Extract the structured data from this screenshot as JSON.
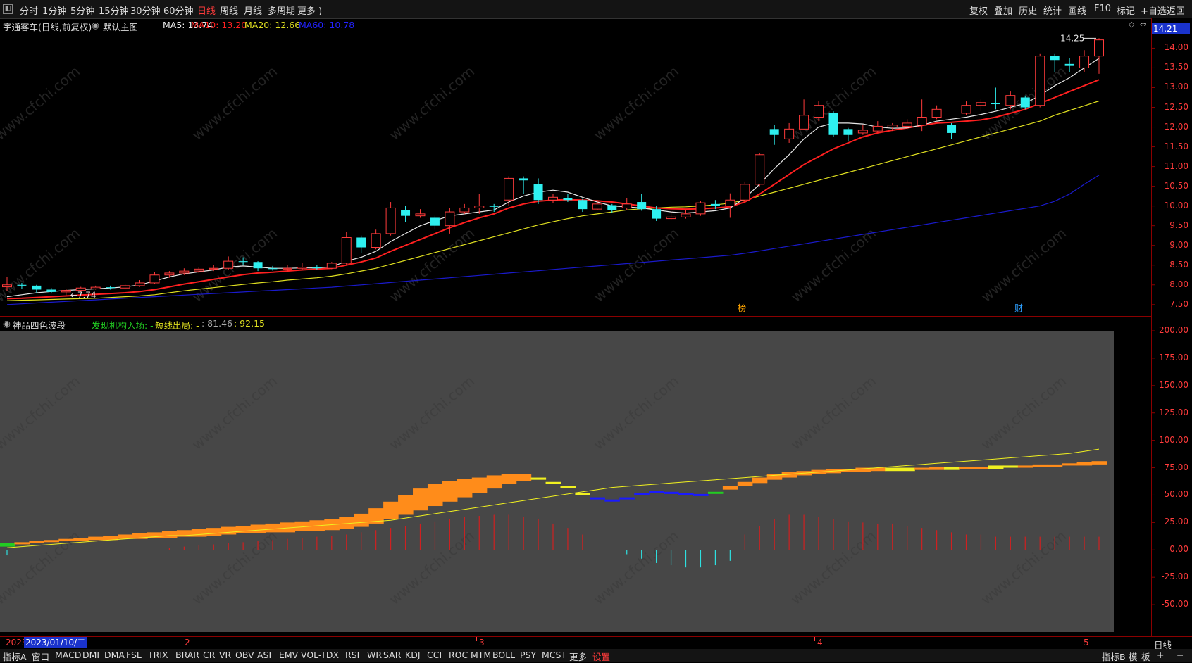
{
  "toolbar": {
    "periods": [
      "分时",
      "1分钟",
      "5分钟",
      "15分钟",
      "30分钟",
      "60分钟",
      "日线",
      "周线",
      "月线",
      "多周期",
      "更多 )"
    ],
    "active_period": "日线",
    "right_tools": [
      "复权",
      "叠加",
      "历史",
      "统计",
      "画线",
      "F10",
      "标记",
      "+自选",
      "返回"
    ]
  },
  "main_header": {
    "stock": "宇通客车(日线,前复权)",
    "template": "默认主图",
    "ma5": "MA5: 13.74",
    "ma10": "MA10: 13.20",
    "ma20": "MA20: 12.66",
    "ma60": "MA60: 10.78"
  },
  "price_tag": "14.21",
  "high_label": "14.25",
  "low_label": "7.74",
  "markers": {
    "bang": "榜",
    "cai": "财"
  },
  "sub_header": {
    "name": "神品四色波段",
    "entry": "发现机构入场: -",
    "exit": "短线出局: -",
    "v1": ": 81.46",
    "v2": ": 92.15"
  },
  "date_bar": {
    "year_prefix": "2023",
    "cursor_date": "2023/01/10/二",
    "month_marks": [
      "2",
      "3",
      "4",
      "5"
    ],
    "right_label": "日线"
  },
  "bottom_bar": {
    "left": [
      "指标A",
      "窗口",
      "MACD",
      "DMI",
      "DMA",
      "FSL",
      "TRIX",
      "BRAR",
      "CR",
      "VR",
      "OBV",
      "ASI",
      "EMV",
      "VOL-TDX",
      "RSI",
      "WR",
      "SAR",
      "KDJ",
      "CCI",
      "ROC",
      "MTM",
      "BOLL",
      "PSY",
      "MCST",
      "更多",
      "设置"
    ],
    "right": [
      "指标B",
      "模",
      "板",
      "+",
      "−"
    ]
  },
  "watermark": "www.cfchi.com",
  "colors": {
    "up": "#ff3b3b",
    "down": "#2ef0f0",
    "ma5": "#e8e8e8",
    "ma10": "#ff2020",
    "ma20": "#e0e020",
    "ma60": "#1a1acc",
    "band": "#ff8c1a",
    "band_yellow": "#f0f020",
    "band_blue": "#1a1aff",
    "band_green": "#22cc22",
    "sub_bg": "#474747"
  },
  "chart_data": [
    {
      "type": "candlestick",
      "title": "宇通客车(日线,前复权)",
      "ylim": [
        7.3,
        14.4
      ],
      "y_ticks": [
        7.5,
        8.0,
        8.5,
        9.0,
        9.5,
        10.0,
        10.5,
        11.0,
        11.5,
        12.0,
        12.5,
        13.0,
        13.5,
        14.0
      ],
      "candles": [
        [
          7.95,
          8.0,
          8.2,
          7.85
        ],
        [
          8.0,
          7.98,
          8.05,
          7.9
        ],
        [
          7.98,
          7.88,
          8.0,
          7.8
        ],
        [
          7.88,
          7.82,
          7.92,
          7.78
        ],
        [
          7.82,
          7.86,
          7.9,
          7.74
        ],
        [
          7.86,
          7.92,
          7.95,
          7.82
        ],
        [
          7.9,
          7.94,
          7.98,
          7.88
        ],
        [
          7.94,
          7.92,
          7.98,
          7.88
        ],
        [
          7.92,
          7.98,
          8.02,
          7.9
        ],
        [
          7.98,
          8.05,
          8.12,
          7.95
        ],
        [
          8.05,
          8.25,
          8.32,
          8.02
        ],
        [
          8.25,
          8.3,
          8.35,
          8.18
        ],
        [
          8.3,
          8.35,
          8.42,
          8.25
        ],
        [
          8.35,
          8.4,
          8.45,
          8.3
        ],
        [
          8.4,
          8.42,
          8.5,
          8.35
        ],
        [
          8.42,
          8.6,
          8.72,
          8.38
        ],
        [
          8.6,
          8.58,
          8.7,
          8.5
        ],
        [
          8.58,
          8.42,
          8.6,
          8.35
        ],
        [
          8.42,
          8.4,
          8.48,
          8.36
        ],
        [
          8.4,
          8.42,
          8.5,
          8.34
        ],
        [
          8.42,
          8.45,
          8.55,
          8.38
        ],
        [
          8.45,
          8.42,
          8.5,
          8.38
        ],
        [
          8.42,
          8.55,
          8.58,
          8.4
        ],
        [
          8.55,
          9.2,
          9.35,
          8.5
        ],
        [
          9.2,
          8.95,
          9.25,
          8.8
        ],
        [
          8.95,
          9.3,
          9.4,
          8.9
        ],
        [
          9.3,
          9.95,
          10.1,
          9.25
        ],
        [
          9.9,
          9.75,
          10.0,
          9.6
        ],
        [
          9.75,
          9.8,
          9.92,
          9.7
        ],
        [
          9.7,
          9.5,
          9.75,
          9.4
        ],
        [
          9.5,
          9.85,
          9.95,
          9.3
        ],
        [
          9.85,
          9.95,
          10.05,
          9.8
        ],
        [
          9.95,
          10.0,
          10.3,
          9.8
        ],
        [
          10.0,
          9.98,
          10.05,
          9.85
        ],
        [
          10.15,
          10.7,
          10.75,
          10.0
        ],
        [
          10.7,
          10.65,
          10.75,
          10.3
        ],
        [
          10.55,
          10.15,
          10.7,
          10.05
        ],
        [
          10.15,
          10.22,
          10.3,
          10.08
        ],
        [
          10.2,
          10.15,
          10.3,
          10.1
        ],
        [
          10.15,
          9.92,
          10.18,
          9.85
        ],
        [
          9.92,
          10.05,
          10.15,
          9.9
        ],
        [
          10.02,
          9.9,
          10.05,
          9.82
        ],
        [
          9.95,
          10.05,
          10.2,
          9.9
        ],
        [
          10.1,
          9.92,
          10.3,
          9.88
        ],
        [
          9.92,
          9.68,
          10.0,
          9.62
        ],
        [
          9.68,
          9.72,
          9.85,
          9.65
        ],
        [
          9.72,
          9.8,
          9.9,
          9.68
        ],
        [
          9.8,
          10.08,
          10.12,
          9.75
        ],
        [
          10.05,
          10.0,
          10.15,
          9.92
        ],
        [
          10.0,
          10.15,
          10.32,
          9.7
        ],
        [
          10.15,
          10.55,
          10.62,
          10.1
        ],
        [
          10.55,
          11.3,
          11.35,
          10.5
        ],
        [
          11.95,
          11.8,
          12.05,
          11.55
        ],
        [
          11.7,
          11.95,
          12.1,
          11.6
        ],
        [
          11.95,
          12.3,
          12.7,
          11.95
        ],
        [
          12.25,
          12.55,
          12.65,
          12.15
        ],
        [
          12.35,
          11.8,
          12.4,
          11.75
        ],
        [
          11.95,
          11.8,
          11.98,
          11.65
        ],
        [
          11.85,
          11.92,
          12.05,
          11.8
        ],
        [
          11.9,
          12.02,
          12.15,
          11.88
        ],
        [
          12.0,
          12.05,
          12.1,
          11.9
        ],
        [
          12.02,
          12.1,
          12.2,
          11.95
        ],
        [
          12.05,
          12.25,
          12.7,
          11.9
        ],
        [
          12.25,
          12.45,
          12.55,
          12.2
        ],
        [
          12.05,
          11.85,
          12.1,
          11.7
        ],
        [
          12.35,
          12.55,
          12.65,
          12.3
        ],
        [
          12.55,
          12.62,
          12.7,
          12.4
        ],
        [
          12.6,
          12.58,
          13.0,
          12.45
        ],
        [
          12.55,
          12.8,
          12.9,
          12.45
        ],
        [
          12.75,
          12.5,
          12.8,
          12.45
        ],
        [
          12.55,
          13.8,
          13.85,
          12.5
        ],
        [
          13.8,
          13.7,
          13.85,
          13.4
        ],
        [
          13.6,
          13.55,
          13.75,
          13.4
        ],
        [
          13.5,
          13.8,
          13.95,
          13.4
        ],
        [
          13.8,
          14.21,
          14.25,
          13.35
        ]
      ],
      "ma5": [
        7.7,
        7.75,
        7.8,
        7.83,
        7.86,
        7.88,
        7.9,
        7.92,
        7.95,
        8.0,
        8.1,
        8.2,
        8.28,
        8.33,
        8.38,
        8.45,
        8.48,
        8.45,
        8.42,
        8.42,
        8.43,
        8.43,
        8.46,
        8.6,
        8.7,
        8.85,
        9.1,
        9.3,
        9.5,
        9.63,
        9.75,
        9.8,
        9.85,
        9.9,
        10.1,
        10.25,
        10.35,
        10.4,
        10.35,
        10.22,
        10.1,
        10.0,
        9.98,
        9.95,
        9.9,
        9.85,
        9.82,
        9.85,
        9.88,
        9.95,
        10.2,
        10.55,
        10.95,
        11.3,
        11.7,
        12.0,
        12.1,
        12.1,
        12.08,
        12.0,
        11.97,
        11.98,
        12.05,
        12.15,
        12.2,
        12.25,
        12.32,
        12.4,
        12.5,
        12.6,
        12.8,
        13.05,
        13.25,
        13.5,
        13.74
      ],
      "ma10": [
        7.65,
        7.66,
        7.68,
        7.7,
        7.72,
        7.74,
        7.76,
        7.78,
        7.8,
        7.83,
        7.88,
        7.95,
        8.02,
        8.08,
        8.14,
        8.2,
        8.26,
        8.3,
        8.32,
        8.35,
        8.38,
        8.4,
        8.42,
        8.5,
        8.58,
        8.68,
        8.85,
        9.0,
        9.15,
        9.3,
        9.45,
        9.58,
        9.7,
        9.8,
        9.95,
        10.05,
        10.12,
        10.15,
        10.16,
        10.15,
        10.13,
        10.1,
        10.05,
        10.0,
        9.95,
        9.93,
        9.92,
        9.93,
        9.95,
        9.98,
        10.1,
        10.3,
        10.55,
        10.8,
        11.05,
        11.25,
        11.45,
        11.6,
        11.75,
        11.85,
        11.92,
        11.98,
        12.04,
        12.1,
        12.12,
        12.15,
        12.18,
        12.25,
        12.35,
        12.45,
        12.6,
        12.75,
        12.9,
        13.05,
        13.2
      ],
      "ma20": [
        7.6,
        7.61,
        7.62,
        7.63,
        7.64,
        7.65,
        7.66,
        7.68,
        7.7,
        7.72,
        7.75,
        7.8,
        7.85,
        7.89,
        7.93,
        7.97,
        8.01,
        8.05,
        8.08,
        8.12,
        8.15,
        8.18,
        8.22,
        8.28,
        8.35,
        8.42,
        8.52,
        8.62,
        8.72,
        8.82,
        8.92,
        9.02,
        9.12,
        9.22,
        9.32,
        9.42,
        9.52,
        9.6,
        9.68,
        9.75,
        9.8,
        9.85,
        9.9,
        9.93,
        9.95,
        9.97,
        9.98,
        10.0,
        10.03,
        10.07,
        10.15,
        10.25,
        10.35,
        10.45,
        10.55,
        10.65,
        10.75,
        10.85,
        10.95,
        11.05,
        11.15,
        11.25,
        11.35,
        11.45,
        11.55,
        11.65,
        11.75,
        11.85,
        11.95,
        12.05,
        12.15,
        12.3,
        12.42,
        12.54,
        12.66
      ],
      "ma60": [
        7.5,
        7.52,
        7.54,
        7.56,
        7.58,
        7.6,
        7.62,
        7.64,
        7.66,
        7.68,
        7.7,
        7.72,
        7.74,
        7.76,
        7.78,
        7.8,
        7.82,
        7.84,
        7.86,
        7.88,
        7.9,
        7.92,
        7.94,
        7.97,
        8.0,
        8.03,
        8.06,
        8.09,
        8.12,
        8.15,
        8.18,
        8.21,
        8.24,
        8.27,
        8.3,
        8.33,
        8.36,
        8.39,
        8.42,
        8.45,
        8.48,
        8.51,
        8.54,
        8.57,
        8.6,
        8.63,
        8.66,
        8.69,
        8.72,
        8.75,
        8.8,
        8.86,
        8.92,
        8.98,
        9.04,
        9.1,
        9.16,
        9.22,
        9.28,
        9.34,
        9.4,
        9.46,
        9.52,
        9.58,
        9.64,
        9.7,
        9.76,
        9.82,
        9.88,
        9.94,
        10.0,
        10.12,
        10.3,
        10.55,
        10.78
      ]
    },
    {
      "type": "area",
      "title": "神品四色波段",
      "ylim": [
        -75,
        200
      ],
      "y_ticks": [
        200,
        175,
        150,
        125,
        100,
        75,
        50,
        25,
        0,
        -25,
        -50
      ],
      "upper": [
        3,
        6,
        8,
        9,
        10,
        11,
        12,
        13,
        14,
        15,
        16,
        17,
        18,
        19,
        20,
        21,
        22,
        23,
        24,
        25,
        26,
        27,
        28,
        30,
        33,
        38,
        44,
        50,
        56,
        60,
        63,
        65,
        66,
        68,
        69,
        69,
        66,
        62,
        58,
        52,
        48,
        46,
        48,
        52,
        54,
        53,
        52,
        51,
        52,
        58,
        62,
        66,
        69,
        71,
        72,
        73,
        74,
        74,
        75,
        75,
        75,
        75,
        75,
        76,
        76,
        76,
        76,
        77,
        77,
        77,
        78,
        78,
        79,
        80,
        81
      ],
      "lower": [
        6,
        7,
        7,
        8,
        8,
        8,
        9,
        9,
        10,
        10,
        11,
        11,
        12,
        12,
        13,
        14,
        15,
        15,
        16,
        16,
        17,
        17,
        18,
        19,
        21,
        24,
        28,
        32,
        36,
        40,
        44,
        48,
        52,
        56,
        60,
        63,
        64,
        62,
        58,
        52,
        47,
        46,
        48,
        51,
        52,
        51,
        50,
        51,
        53,
        55,
        58,
        61,
        64,
        66,
        68,
        69,
        70,
        71,
        71,
        72,
        72,
        72,
        73,
        73,
        73,
        74,
        74,
        74,
        75,
        75,
        76,
        76,
        77,
        77,
        78
      ],
      "band_colors": [
        "green",
        "orange",
        "orange",
        "orange",
        "orange",
        "orange",
        "orange",
        "orange",
        "orange",
        "orange",
        "orange",
        "orange",
        "orange",
        "orange",
        "orange",
        "orange",
        "orange",
        "orange",
        "orange",
        "orange",
        "orange",
        "orange",
        "orange",
        "orange",
        "orange",
        "orange",
        "orange",
        "orange",
        "orange",
        "orange",
        "orange",
        "orange",
        "orange",
        "orange",
        "orange",
        "orange",
        "yellow",
        "yellow",
        "yellow",
        "yellow",
        "blue",
        "blue",
        "blue",
        "blue",
        "blue",
        "blue",
        "blue",
        "blue",
        "green",
        "orange",
        "orange",
        "orange",
        "orange",
        "orange",
        "orange",
        "orange",
        "orange",
        "orange",
        "orange",
        "orange",
        "yellow",
        "yellow",
        "orange",
        "orange",
        "yellow",
        "orange",
        "orange",
        "yellow",
        "yellow",
        "orange",
        "orange",
        "orange",
        "orange",
        "orange",
        "orange"
      ],
      "yellow_line": [
        2,
        3,
        4,
        5,
        6,
        7,
        8,
        9,
        10,
        11,
        12,
        13,
        13,
        14,
        15,
        16,
        17,
        18,
        19,
        20,
        21,
        22,
        23,
        24,
        25,
        26,
        27,
        29,
        31,
        33,
        35,
        37,
        39,
        41,
        43,
        45,
        47,
        49,
        51,
        53,
        55,
        57,
        58,
        59,
        60,
        61,
        62,
        63,
        64,
        65,
        66,
        67,
        68,
        69,
        70,
        71,
        72,
        73,
        74,
        75,
        76,
        77,
        78,
        79,
        80,
        81,
        82,
        83,
        84,
        85,
        86,
        87,
        88,
        90,
        92
      ],
      "hist": [
        -5,
        0,
        0,
        0,
        0,
        0,
        0,
        0,
        0,
        0,
        0,
        2,
        3,
        4,
        5,
        6,
        7,
        8,
        9,
        10,
        11,
        12,
        13,
        14,
        16,
        18,
        20,
        22,
        24,
        26,
        28,
        30,
        31,
        32,
        32,
        30,
        28,
        24,
        20,
        14,
        0,
        0,
        -4,
        -8,
        -12,
        -14,
        -16,
        -16,
        -14,
        -10,
        14,
        22,
        28,
        32,
        32,
        30,
        28,
        26,
        25,
        24,
        24,
        22,
        20,
        18,
        16,
        14,
        14,
        12,
        12,
        12,
        12,
        12,
        12,
        12,
        12
      ]
    }
  ]
}
